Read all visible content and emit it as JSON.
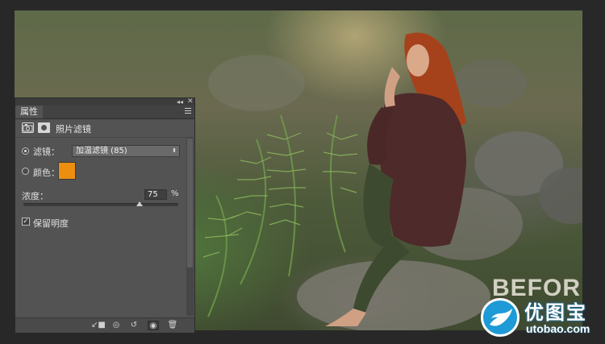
{
  "panel": {
    "tab_label": "属性",
    "header_title": "照片滤镜",
    "filter_label": "滤镜：",
    "filter_value": "加温滤镜 (85)",
    "color_label": "颜色：",
    "color_hex": "#ec8e10",
    "density_label": "浓度：",
    "density_value": "75",
    "density_unit": "%",
    "density_fraction": 0.75,
    "preserve_label": "保留明度",
    "preserve_checked": true,
    "filter_selected": true
  },
  "canvas": {
    "overlay_text": "BEFORE"
  },
  "watermark": {
    "cn": "优图宝",
    "url": "utobao.com"
  },
  "colors": {
    "panel_bg": "#535353",
    "app_bg": "#282828",
    "watermark_blue": "#1e9ad6"
  }
}
